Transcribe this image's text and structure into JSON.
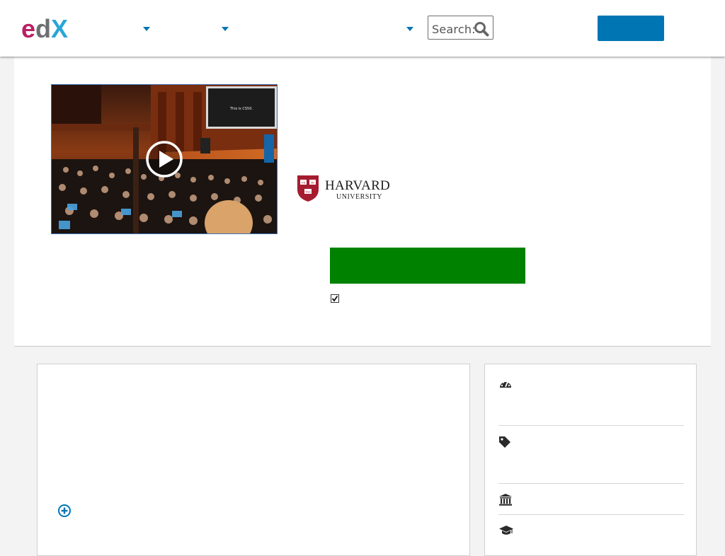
{
  "header": {
    "logo_text": "edX",
    "search": {
      "label": "Search:",
      "icon": "search-icon"
    },
    "nav_dropdown_icons": [
      "chevron-down-icon",
      "chevron-down-icon",
      "chevron-down-icon"
    ],
    "signin_label": ""
  },
  "hero": {
    "video": {
      "screen_text": "This is CS50.",
      "play_icon": "play-icon"
    },
    "university_logo": {
      "name": "HARVARD",
      "subtitle": "UNIVERSITY",
      "shield_text": [
        "VE",
        "RI",
        "TAS"
      ]
    },
    "enroll_button_label": "",
    "checkbox_checked": true
  },
  "sidebar": {
    "icons": [
      "gauge-icon",
      "tag-icon",
      "institution-icon",
      "graduation-cap-icon"
    ]
  },
  "main": {
    "expand_icon": "plus-circle-icon"
  },
  "colors": {
    "accent_blue": "#0075b4",
    "enroll_green": "#008100",
    "harvard_crimson": "#a51c30",
    "edx_magenta": "#b91f62",
    "edx_teal": "#2aa6d8"
  }
}
